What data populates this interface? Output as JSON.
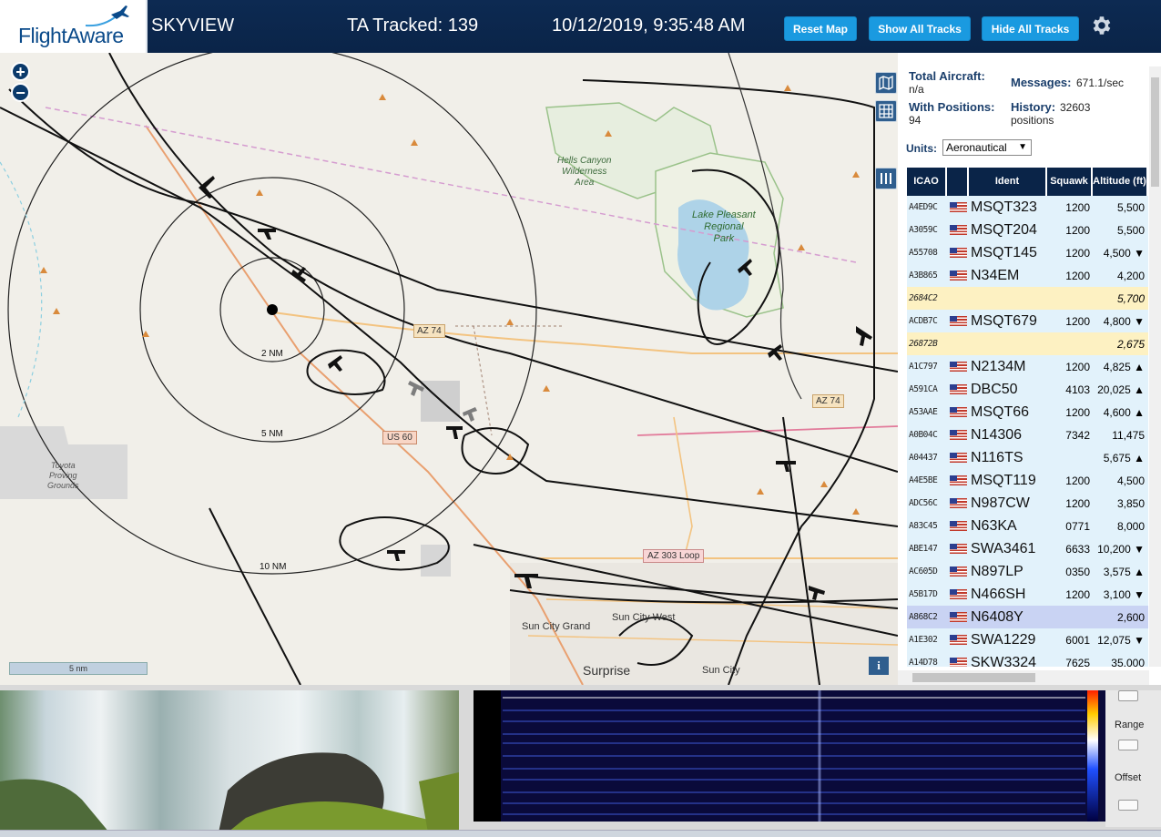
{
  "header": {
    "logo_text": "FlightAware",
    "app_title": "SKYVIEW",
    "tracked": "TA Tracked: 139",
    "datetime": "10/12/2019, 9:35:48 AM",
    "buttons": {
      "reset": "Reset Map",
      "show": "Show All Tracks",
      "hide": "Hide All Tracks"
    }
  },
  "map": {
    "labels": {
      "hells_canyon": [
        "Hells Canyon",
        "Wilderness",
        "Area"
      ],
      "lake_pleasant": [
        "Lake Pleasant",
        "Regional",
        "Park"
      ],
      "toyota": [
        "Toyota",
        "Proving",
        "Grounds"
      ],
      "sun_city_grand": "Sun City Grand",
      "sun_city_west": "Sun City West",
      "sun_city": "Sun City",
      "surprise": "Surprise"
    },
    "road_badges": {
      "az74a": "AZ 74",
      "az74b": "AZ 74",
      "us60": "US 60",
      "az303": "AZ 303 Loop"
    },
    "range_rings": {
      "r2": "2 NM",
      "r5": "5 NM",
      "r10": "10 NM"
    },
    "scale": "5 nm"
  },
  "panel": {
    "total_aircraft_label": "Total Aircraft:",
    "total_aircraft_value": "n/a",
    "with_positions_label": "With Positions:",
    "with_positions_value": "94",
    "messages_label": "Messages:",
    "messages_value": "671.1/sec",
    "history_label": "History:",
    "history_value": "32603",
    "history_unit": "positions",
    "units_label": "Units:",
    "units_value": "Aeronautical",
    "columns": [
      "ICAO",
      "Ident",
      "Squawk",
      "Altitude (ft)"
    ],
    "rows": [
      {
        "icao": "A4ED9C",
        "ident": "MSQT323",
        "squawk": "1200",
        "alt": "5,500",
        "bg": "#e2f2fb",
        "flag": true
      },
      {
        "icao": "A3059C",
        "ident": "MSQT204",
        "squawk": "1200",
        "alt": "5,500",
        "bg": "#e2f2fb",
        "flag": true
      },
      {
        "icao": "A55708",
        "ident": "MSQT145",
        "squawk": "1200",
        "alt": "4,500 ▼",
        "bg": "#e2f2fb",
        "flag": true
      },
      {
        "icao": "A3B865",
        "ident": "N34EM",
        "squawk": "1200",
        "alt": "4,200",
        "bg": "#e2f2fb",
        "flag": true
      },
      {
        "icao": "2684C2",
        "ident": "",
        "squawk": "",
        "alt": "5,700",
        "bg": "#fdf1c2",
        "flag": false
      },
      {
        "icao": "ACDB7C",
        "ident": "MSQT679",
        "squawk": "1200",
        "alt": "4,800 ▼",
        "bg": "#e2f2fb",
        "flag": true
      },
      {
        "icao": "26872B",
        "ident": "",
        "squawk": "",
        "alt": "2,675",
        "bg": "#fdf1c2",
        "flag": false
      },
      {
        "icao": "A1C797",
        "ident": "N2134M",
        "squawk": "1200",
        "alt": "4,825 ▲",
        "bg": "#e2f2fb",
        "flag": true
      },
      {
        "icao": "A591CA",
        "ident": "DBC50",
        "squawk": "4103",
        "alt": "20,025 ▲",
        "bg": "#e2f2fb",
        "flag": true
      },
      {
        "icao": "A53AAE",
        "ident": "MSQT66",
        "squawk": "1200",
        "alt": "4,600 ▲",
        "bg": "#e2f2fb",
        "flag": true
      },
      {
        "icao": "A0B04C",
        "ident": "N14306",
        "squawk": "7342",
        "alt": "11,475",
        "bg": "#e2f2fb",
        "flag": true
      },
      {
        "icao": "A04437",
        "ident": "N116TS",
        "squawk": "",
        "alt": "5,675 ▲",
        "bg": "#e2f2fb",
        "flag": true
      },
      {
        "icao": "A4E5BE",
        "ident": "MSQT119",
        "squawk": "1200",
        "alt": "4,500",
        "bg": "#e2f2fb",
        "flag": true
      },
      {
        "icao": "ADC56C",
        "ident": "N987CW",
        "squawk": "1200",
        "alt": "3,850",
        "bg": "#e2f2fb",
        "flag": true
      },
      {
        "icao": "A83C45",
        "ident": "N63KA",
        "squawk": "0771",
        "alt": "8,000",
        "bg": "#e2f2fb",
        "flag": true
      },
      {
        "icao": "ABE147",
        "ident": "SWA3461",
        "squawk": "6633",
        "alt": "10,200 ▼",
        "bg": "#e2f2fb",
        "flag": true
      },
      {
        "icao": "AC605D",
        "ident": "N897LP",
        "squawk": "0350",
        "alt": "3,575 ▲",
        "bg": "#e2f2fb",
        "flag": true
      },
      {
        "icao": "A5B17D",
        "ident": "N466SH",
        "squawk": "1200",
        "alt": "3,100 ▼",
        "bg": "#e2f2fb",
        "flag": true
      },
      {
        "icao": "A868C2",
        "ident": "N6408Y",
        "squawk": "",
        "alt": "2,600",
        "bg": "#c9d3f3",
        "flag": true
      },
      {
        "icao": "A1E302",
        "ident": "SWA1229",
        "squawk": "6001",
        "alt": "12,075 ▼",
        "bg": "#e2f2fb",
        "flag": true
      },
      {
        "icao": "A14D78",
        "ident": "SKW3324",
        "squawk": "7625",
        "alt": "35,000",
        "bg": "#e2f2fb",
        "flag": true
      }
    ]
  },
  "spectrogram": {
    "range_label": "Range",
    "offset_label": "Offset"
  },
  "colors": {
    "header_bg": "#0a2448",
    "button": "#1a9ae0",
    "row_bg": "#e2f2fb",
    "row_nopos": "#fdf1c2",
    "row_selected": "#c9d3f3"
  }
}
